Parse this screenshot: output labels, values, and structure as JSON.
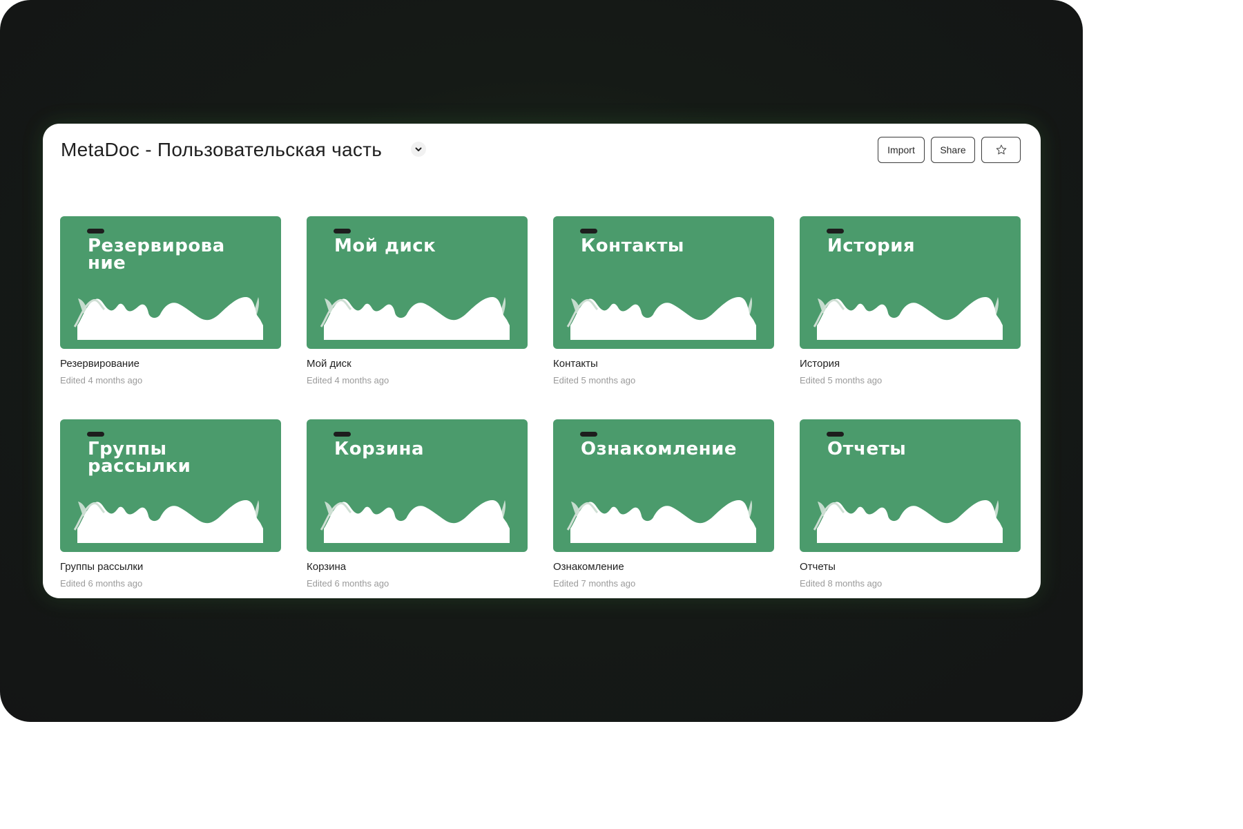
{
  "header": {
    "title": "MetaDoc - Пользовательская часть",
    "import_label": "Import",
    "share_label": "Share"
  },
  "icons": {
    "dropdown": "chevron-down-icon",
    "favorite": "star-icon"
  },
  "colors": {
    "card": "#4b9b6c",
    "card_title": "#ffffff",
    "background": "#141515"
  },
  "cards": [
    {
      "cover_title": "Резервирова\nние",
      "name": "Резервирование",
      "edited": "Edited 4 months ago"
    },
    {
      "cover_title": "Мой диск",
      "name": "Мой диск",
      "edited": "Edited 4 months ago"
    },
    {
      "cover_title": "Контакты",
      "name": "Контакты",
      "edited": "Edited 5 months ago"
    },
    {
      "cover_title": "История",
      "name": "История",
      "edited": "Edited 5 months ago"
    },
    {
      "cover_title": "Группы\nрассылки",
      "name": "Группы рассылки",
      "edited": "Edited 6 months ago"
    },
    {
      "cover_title": "Корзина",
      "name": "Корзина",
      "edited": "Edited 6 months ago"
    },
    {
      "cover_title": "Ознакомление",
      "name": "Ознакомление",
      "edited": "Edited 7 months ago"
    },
    {
      "cover_title": "Отчеты",
      "name": "Отчеты",
      "edited": "Edited 8 months ago"
    }
  ]
}
